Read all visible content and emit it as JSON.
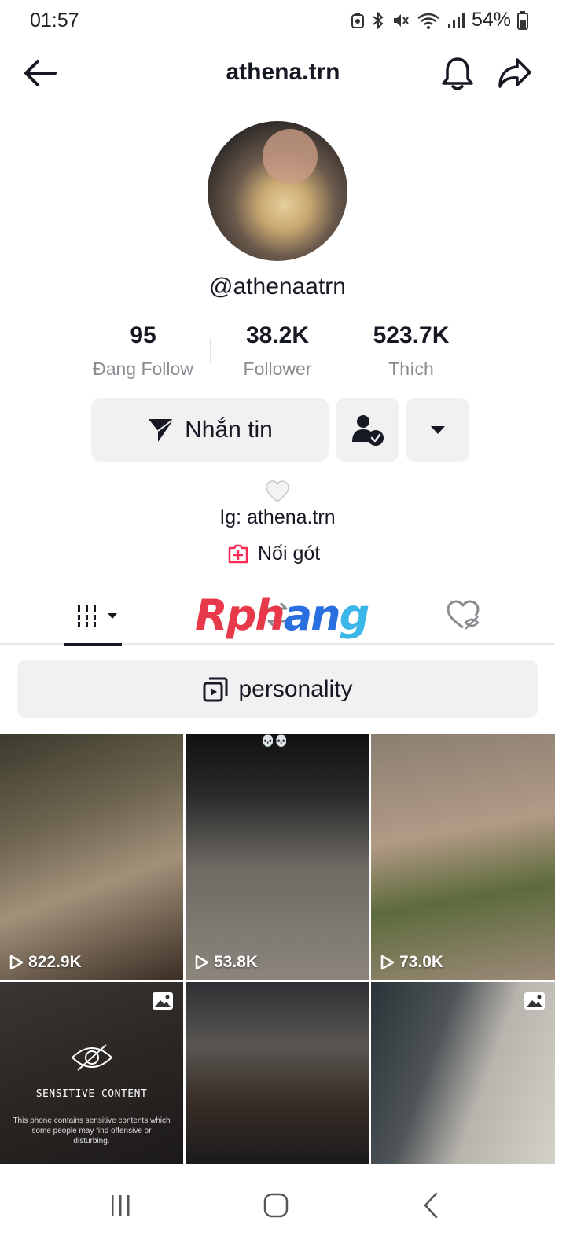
{
  "status": {
    "time": "01:57",
    "battery": "54%",
    "icons": [
      "alarm-icon",
      "bluetooth-icon",
      "mute-icon",
      "wifi-icon",
      "signal-icon",
      "battery-icon"
    ]
  },
  "header": {
    "title": "athena.trn"
  },
  "profile": {
    "handle": "@athenaatrn",
    "stats": [
      {
        "value": "95",
        "label": "Đang Follow"
      },
      {
        "value": "38.2K",
        "label": "Follower"
      },
      {
        "value": "523.7K",
        "label": "Thích"
      }
    ],
    "message_button": "Nhắn tin",
    "bio_emoji": "🤍",
    "bio": "Ig: athena.trn",
    "link_label": "Nối gót"
  },
  "tabs": {
    "watermark": [
      "Rph",
      "an",
      "g"
    ]
  },
  "playlist": {
    "label": "personality"
  },
  "grid": {
    "items": [
      {
        "views": "822.9K"
      },
      {
        "views": "53.8K",
        "caption": "💀💀"
      },
      {
        "views": "73.0K"
      },
      {
        "sensitive_title": "SENSITIVE CONTENT",
        "sensitive_desc": "This phone contains sensitive contents which some people may find offensive or disturbing."
      },
      {},
      {}
    ]
  },
  "colors": {
    "text": "#161823",
    "secondary": "#8a8b91",
    "button_bg": "#f1f1f2",
    "accent_pink": "#fe2c55"
  }
}
